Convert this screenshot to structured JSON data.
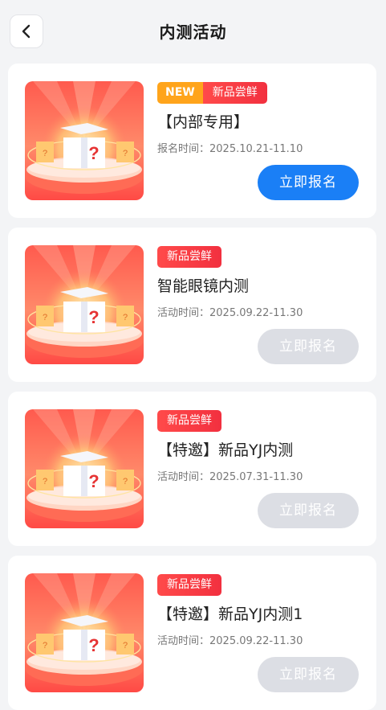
{
  "header": {
    "title": "内测活动"
  },
  "colors": {
    "accent": "#1a7ff6",
    "tag_new": "#ffa41b",
    "tag_fresh": "#f2303f",
    "disabled": "#dcdee4"
  },
  "cards": [
    {
      "tag_new": "NEW",
      "tag": "新品尝鲜",
      "name": "【内部专用】",
      "time": "报名时间：2025.10.21-11.10",
      "button": "立即报名",
      "button_state": "active"
    },
    {
      "tag": "新品尝鲜",
      "name": "智能眼镜内测",
      "time": "活动时间：2025.09.22-11.30",
      "button": "立即报名",
      "button_state": "disabled"
    },
    {
      "tag": "新品尝鲜",
      "name": "【特邀】新品YJ内测",
      "time": "活动时间：2025.07.31-11.30",
      "button": "立即报名",
      "button_state": "disabled"
    },
    {
      "tag": "新品尝鲜",
      "name": "【特邀】新品YJ内测1",
      "time": "活动时间：2025.09.22-11.30",
      "button": "立即报名",
      "button_state": "disabled"
    }
  ]
}
